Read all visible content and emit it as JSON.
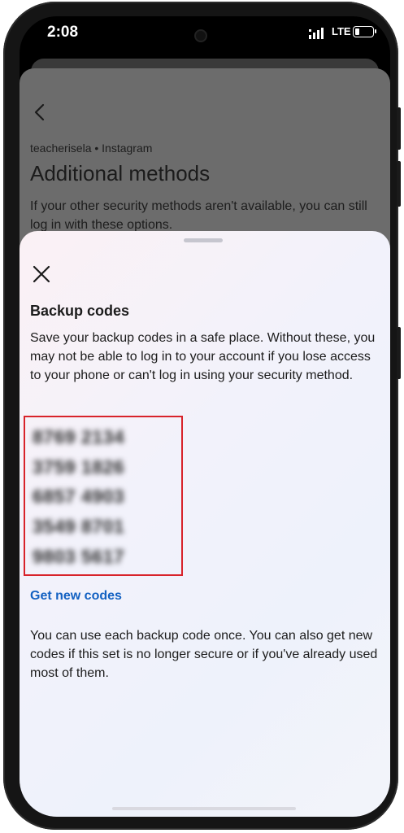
{
  "status_bar": {
    "time": "2:08",
    "network": "LTE"
  },
  "background_page": {
    "account_line": "teacherisela • Instagram",
    "title": "Additional methods",
    "description": "If your other security methods aren't available, you can still log in with these options."
  },
  "sheet": {
    "title": "Backup codes",
    "description": "Save your backup codes in a safe place. Without these, you may not be able to log in to your account if you lose access to your phone or can't log in using your security method.",
    "codes": [
      "8769 2134",
      "3759 1826",
      "6857 4903",
      "3549 8701",
      "9803 5617"
    ],
    "get_new_codes_label": "Get new codes",
    "footer": "You can use each backup code once. You can also get new codes if this set is no longer secure or if you've already used most of them."
  },
  "colors": {
    "link": "#1361c2",
    "highlight_border": "#d8232a"
  }
}
